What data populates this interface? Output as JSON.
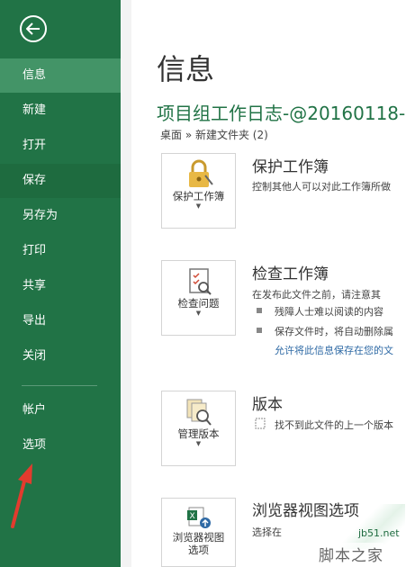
{
  "sidebar": {
    "items": [
      {
        "label": "信息"
      },
      {
        "label": "新建"
      },
      {
        "label": "打开"
      },
      {
        "label": "保存"
      },
      {
        "label": "另存为"
      },
      {
        "label": "打印"
      },
      {
        "label": "共享"
      },
      {
        "label": "导出"
      },
      {
        "label": "关闭"
      },
      {
        "label": "帐户"
      },
      {
        "label": "选项"
      }
    ]
  },
  "main": {
    "title": "信息",
    "doc_title": "项目组工作日志-@20160118-",
    "breadcrumb": "桌面 » 新建文件夹 (2)",
    "sections": [
      {
        "tile_label": "保护工作簿",
        "heading": "保护工作簿",
        "desc": "控制其他人可以对此工作簿所做"
      },
      {
        "tile_label": "检查问题",
        "heading": "检查工作簿",
        "desc": "在发布此文件之前，请注意其",
        "bullets": [
          "残障人士难以阅读的内容",
          "保存文件时，将自动删除属"
        ],
        "link": "允许将此信息保存在您的文"
      },
      {
        "tile_label": "管理版本",
        "heading": "版本",
        "desc": "找不到此文件的上一个版本"
      },
      {
        "tile_label_line1": "浏览器视图",
        "tile_label_line2": "选项",
        "heading": "浏览器视图选项",
        "desc": "选择在"
      }
    ]
  },
  "watermark": {
    "site": "jb51.net",
    "name": "脚本之家"
  },
  "colors": {
    "accent": "#217346",
    "active_item": "#439467",
    "arrow": "#e23b2e"
  }
}
